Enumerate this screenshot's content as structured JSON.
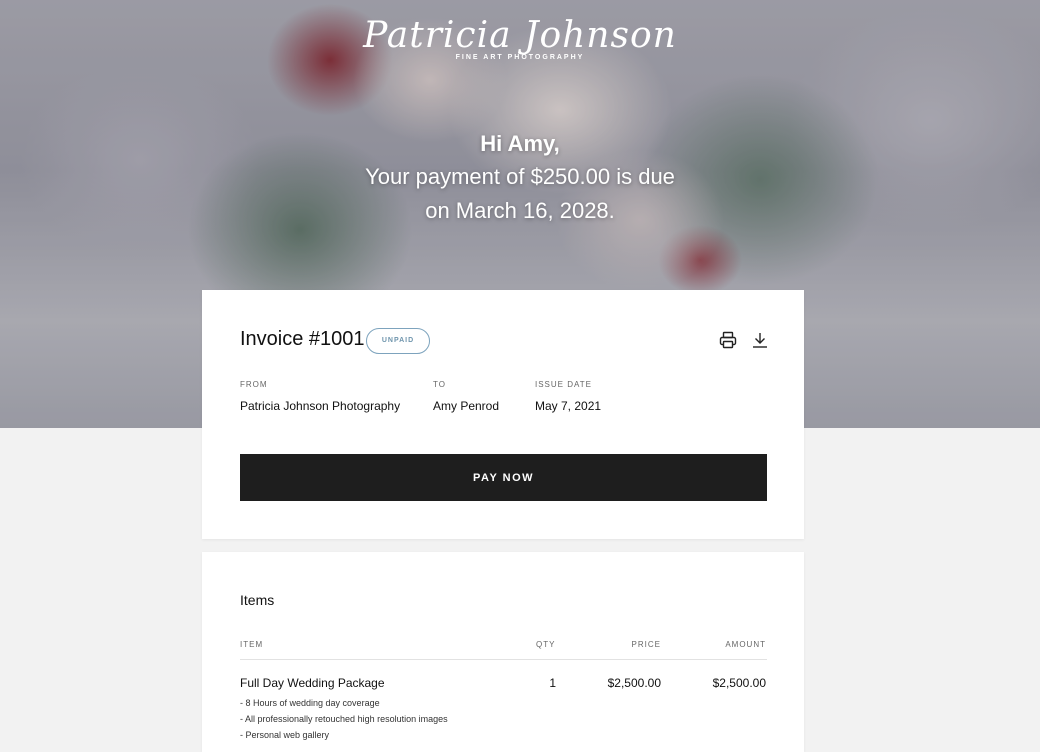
{
  "header": {
    "logo_script": "Patricia Johnson",
    "logo_sub": "FINE ART   PHOTOGRAPHY",
    "greeting": "Hi Amy,",
    "message_line1": "Your payment of $250.00 is due",
    "message_line2": "on March 16, 2028."
  },
  "invoice": {
    "title": "Invoice #1001",
    "status": "UNPAID",
    "status_color": "#7da3bd",
    "print_icon": "printer-icon",
    "download_icon": "download-icon",
    "from_label": "FROM",
    "from_value": "Patricia Johnson Photography",
    "to_label": "TO",
    "to_value": "Amy Penrod",
    "issue_label": "ISSUE DATE",
    "issue_value": "May 7, 2021",
    "pay_button": "PAY NOW"
  },
  "items": {
    "title": "Items",
    "columns": {
      "item": "ITEM",
      "qty": "QTY",
      "price": "PRICE",
      "amount": "AMOUNT"
    },
    "rows": [
      {
        "name": "Full Day Wedding Package",
        "qty": "1",
        "price": "$2,500.00",
        "amount": "$2,500.00",
        "details": [
          "- 8 Hours of wedding day coverage",
          "- All professionally retouched high resolution images",
          "- Personal web gallery"
        ]
      }
    ]
  }
}
